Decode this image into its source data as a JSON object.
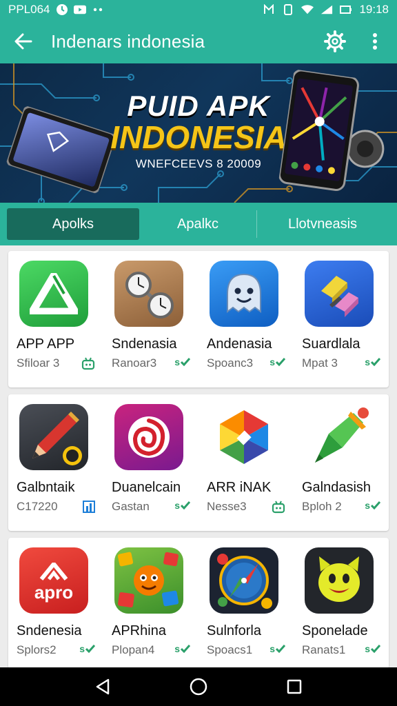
{
  "status": {
    "carrier": "PPL064",
    "time": "19:18"
  },
  "appbar": {
    "title": "Indenars indonesia"
  },
  "banner": {
    "line1": "PUID APK",
    "line2": "INDONESIA",
    "subtitle": "WNEFCEEVS 8 20009"
  },
  "tabs": [
    {
      "label": "Apolks"
    },
    {
      "label": "Apalkc"
    },
    {
      "label": "Llotvneasis"
    }
  ],
  "rows": [
    [
      {
        "name": "APP APP",
        "meta": "Sfiloar 3",
        "badge": "",
        "icon": "green-triangle-icon"
      },
      {
        "name": "Sndenasia",
        "meta": "Ranoar3",
        "badge": "s",
        "icon": "watches-icon"
      },
      {
        "name": "Andenasia",
        "meta": "Spoanc3",
        "badge": "s",
        "icon": "ghost-icon"
      },
      {
        "name": "Suardlala",
        "meta": "Mpat 3",
        "badge": "s",
        "icon": "blocks-icon"
      }
    ],
    [
      {
        "name": "Galbntaik",
        "meta": "C17220",
        "badge": "",
        "icon": "pencil-icon"
      },
      {
        "name": "Duanelcain",
        "meta": "Gastan",
        "badge": "s",
        "icon": "rose-icon"
      },
      {
        "name": "ARR iNAK",
        "meta": "Nesse3",
        "badge": "",
        "icon": "hexagon-icon"
      },
      {
        "name": "Galndasish",
        "meta": "Bploh 2",
        "badge": "s",
        "icon": "crayon-icon"
      }
    ],
    [
      {
        "name": "Sndenesia",
        "meta": "Splors2",
        "badge": "s",
        "icon": "apro-icon"
      },
      {
        "name": "APRhina",
        "meta": "Plopan4",
        "badge": "s",
        "icon": "monster-icon"
      },
      {
        "name": "Sulnforla",
        "meta": "Spoacs1",
        "badge": "s",
        "icon": "compass-icon"
      },
      {
        "name": "Sponelade",
        "meta": "Ranats1",
        "badge": "s",
        "icon": "smiley-icon"
      }
    ]
  ],
  "icon_text": {
    "apro": "apro"
  },
  "colors": {
    "accent": "#2bb39b",
    "active_tab": "#186b5c",
    "badge": "#2aa06a"
  }
}
